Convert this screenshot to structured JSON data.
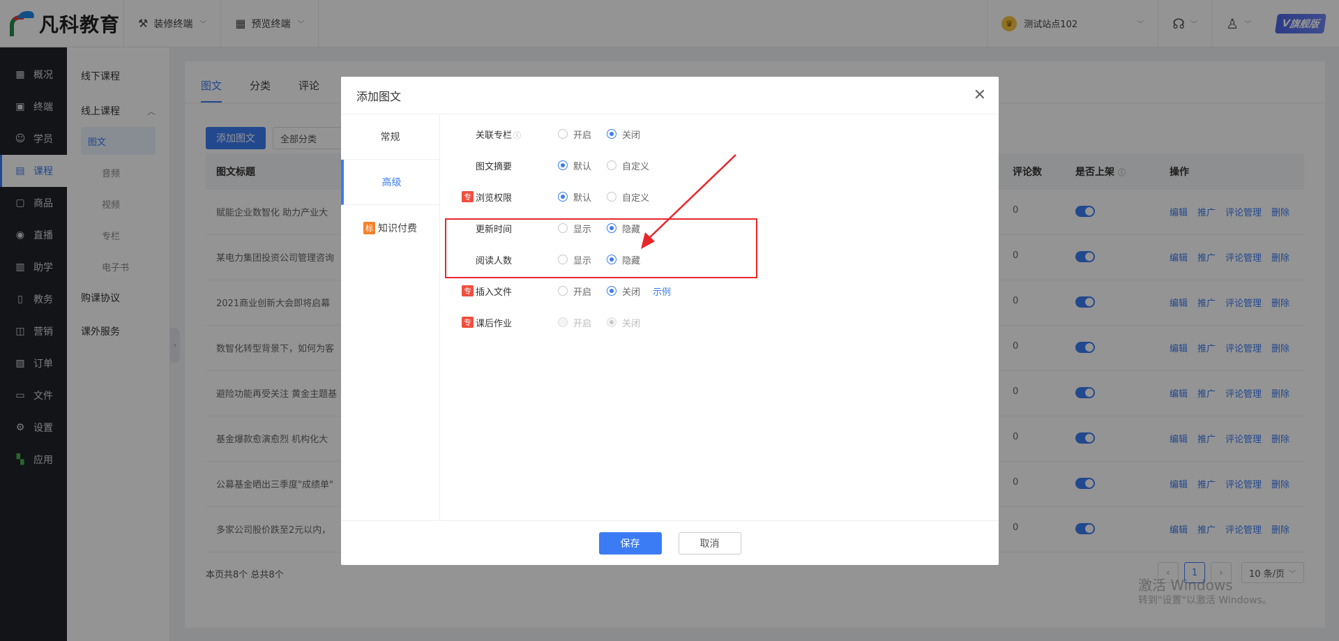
{
  "header": {
    "logo_text": "凡科教育",
    "menu": [
      {
        "label": "装修终端",
        "icon": "paint-roller-icon"
      },
      {
        "label": "预览终端",
        "icon": "grid-icon"
      }
    ],
    "site_name": "测试站点102",
    "vip_label": "旗舰版"
  },
  "leftnav": {
    "items": [
      {
        "label": "概况",
        "icon": "dashboard-icon",
        "glyph": "▦"
      },
      {
        "label": "终端",
        "icon": "terminal-icon",
        "glyph": "▣"
      },
      {
        "label": "学员",
        "icon": "users-icon",
        "glyph": "☺"
      },
      {
        "label": "课程",
        "icon": "course-icon",
        "glyph": "▤"
      },
      {
        "label": "商品",
        "icon": "goods-icon",
        "glyph": "▢"
      },
      {
        "label": "直播",
        "icon": "live-icon",
        "glyph": "◉"
      },
      {
        "label": "助学",
        "icon": "assist-icon",
        "glyph": "▥"
      },
      {
        "label": "教务",
        "icon": "academic-icon",
        "glyph": "▯"
      },
      {
        "label": "营销",
        "icon": "marketing-icon",
        "glyph": "◫"
      },
      {
        "label": "订单",
        "icon": "order-icon",
        "glyph": "▧"
      },
      {
        "label": "文件",
        "icon": "folder-icon",
        "glyph": "▭"
      },
      {
        "label": "设置",
        "icon": "settings-icon",
        "glyph": "⚙"
      },
      {
        "label": "应用",
        "icon": "apps-icon",
        "glyph": "▚"
      }
    ],
    "active": 3
  },
  "subnav": {
    "offline": "线下课程",
    "online": "线上课程",
    "children": [
      "图文",
      "音频",
      "视频",
      "专栏",
      "电子书"
    ],
    "purchase": "购课协议",
    "extra": "课外服务"
  },
  "main": {
    "tabs": [
      "图文",
      "分类",
      "评论"
    ],
    "add_button": "添加图文",
    "category_select": "全部分类",
    "columns": {
      "title": "图文标题",
      "comments": "评论数",
      "listed": "是否上架",
      "ops": "操作"
    },
    "rows": [
      "赋能企业数智化 助力产业大",
      "某电力集团投资公司管理咨询",
      "2021商业创新大会即将启幕",
      "数智化转型背景下，如何为客",
      "避险功能再受关注 黄金主题基",
      "基金爆款愈演愈烈 机构化大",
      "公募基金晒出三季度\"成绩单\"",
      "多家公司股价跌至2元以内，"
    ],
    "comment_value": "0",
    "ops": [
      "编辑",
      "推广",
      "评论管理",
      "删除"
    ],
    "footer_info": "本页共8个 总共8个",
    "current_page": "1",
    "page_size": "10 条/页",
    "watermark_title": "激活 Windows",
    "watermark_sub": "转到\"设置\"以激活 Windows。"
  },
  "modal": {
    "title": "添加图文",
    "side": [
      "常规",
      "高级",
      "知识付费"
    ],
    "side_badge": "标",
    "rows": [
      {
        "label": "关联专栏",
        "badge": "",
        "info": true,
        "options": [
          "开启",
          "关闭"
        ],
        "checked": 1
      },
      {
        "label": "图文摘要",
        "badge": "",
        "options": [
          "默认",
          "自定义"
        ],
        "checked": 0
      },
      {
        "label": "浏览权限",
        "badge": "专",
        "options": [
          "默认",
          "自定义"
        ],
        "checked": 0
      },
      {
        "label": "更新时间",
        "badge": "",
        "options": [
          "显示",
          "隐藏"
        ],
        "checked": 1
      },
      {
        "label": "阅读人数",
        "badge": "",
        "options": [
          "显示",
          "隐藏"
        ],
        "checked": 1
      },
      {
        "label": "插入文件",
        "badge": "专",
        "options": [
          "开启",
          "关闭"
        ],
        "checked": 1,
        "link": "示例"
      },
      {
        "label": "课后作业",
        "badge": "专",
        "options": [
          "开启",
          "关闭"
        ],
        "checked": 1,
        "disabled": true
      }
    ],
    "save": "保存",
    "cancel": "取消"
  },
  "colors": {
    "accent": "#3b7cf4",
    "annotation": "#e8262a"
  }
}
